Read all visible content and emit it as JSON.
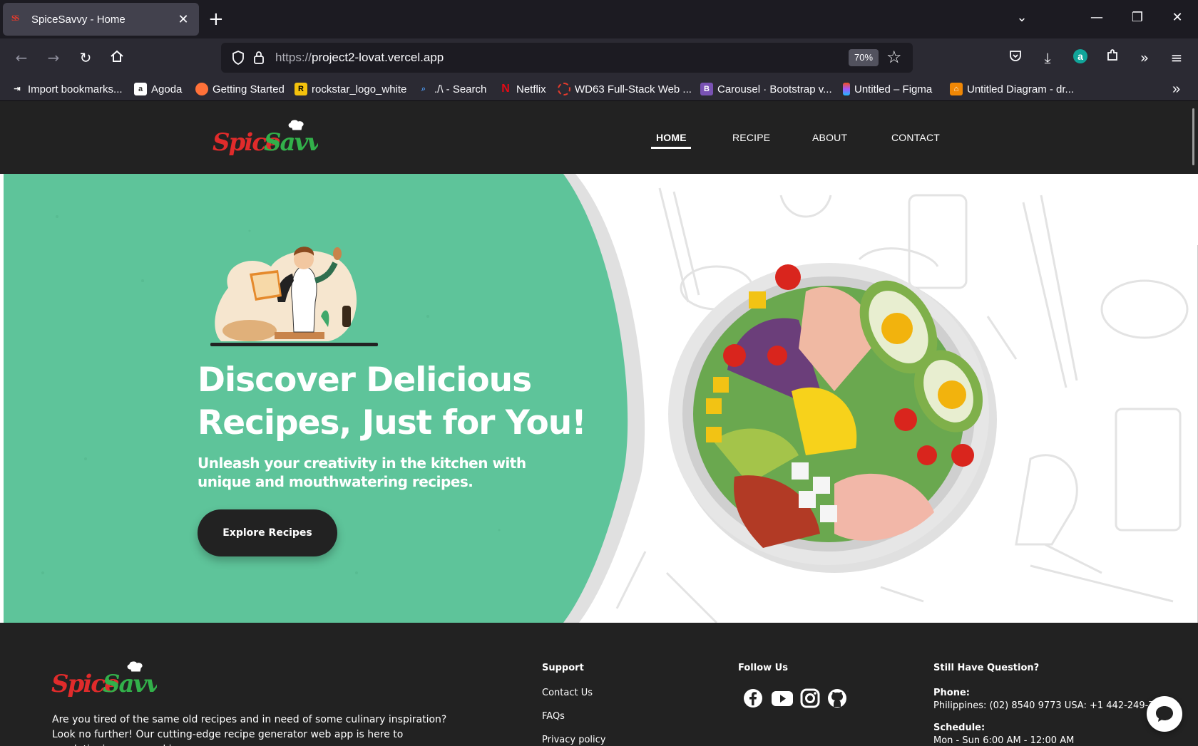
{
  "browser": {
    "tab_title": "SpiceSavvy - Home",
    "tab_favicon": "SS",
    "url_scheme": "https://",
    "url_host": "project2-lovat.vercel.app",
    "zoom": "70%",
    "bookmarks": [
      {
        "label": "Import bookmarks...",
        "icon": "import-icon",
        "color": "#2b2a33"
      },
      {
        "label": "Agoda",
        "icon": "agoda-icon",
        "color": "#ffffff"
      },
      {
        "label": "Getting Started",
        "icon": "firefox-icon",
        "color": "#ff7139"
      },
      {
        "label": "rockstar_logo_white",
        "icon": "rockstar-icon",
        "color": "#f4c20d"
      },
      {
        "label": "./\\ - Search",
        "icon": "search-icon",
        "color": "#2b2a33"
      },
      {
        "label": "Netflix",
        "icon": "netflix-icon",
        "color": "#e50914"
      },
      {
        "label": "WD63 Full-Stack Web ...",
        "icon": "avion-icon",
        "color": "#e43b2c"
      },
      {
        "label": "Carousel · Bootstrap v...",
        "icon": "bootstrap-icon",
        "color": "#7952b3"
      },
      {
        "label": "Untitled – Figma",
        "icon": "figma-icon",
        "color": "#1e1e1e"
      },
      {
        "label": "Untitled Diagram - dr...",
        "icon": "drawio-icon",
        "color": "#f08705"
      }
    ]
  },
  "site": {
    "logo_text": "SpiceSavvy",
    "nav": [
      "HOME",
      "RECIPE",
      "ABOUT",
      "CONTACT"
    ],
    "hero_title": "Discover Delicious Recipes, Just for You!",
    "hero_subtitle": "Unleash your creativity in the kitchen with unique and mouthwatering recipes.",
    "hero_button": "Explore Recipes",
    "colors": {
      "green": "#5ec49a",
      "dark": "#222222"
    }
  },
  "footer": {
    "about": "Are you tired of the same old recipes and in need of some culinary inspiration? Look no further! Our cutting-edge recipe generator web app is here to revolutionize your cooking",
    "support_heading": "Support",
    "support_links": [
      "Contact Us",
      "FAQs",
      "Privacy policy"
    ],
    "follow_heading": "Follow Us",
    "social": [
      "facebook-icon",
      "youtube-icon",
      "instagram-icon",
      "github-icon"
    ],
    "question_heading": "Still Have Question?",
    "phone_label": "Phone:",
    "phone_value": "Philippines: (02) 8540 9773 USA: +1 442-249-77",
    "schedule_label": "Schedule:",
    "schedule_value": "Mon - Sun 6:00 AM - 12:00 AM"
  }
}
